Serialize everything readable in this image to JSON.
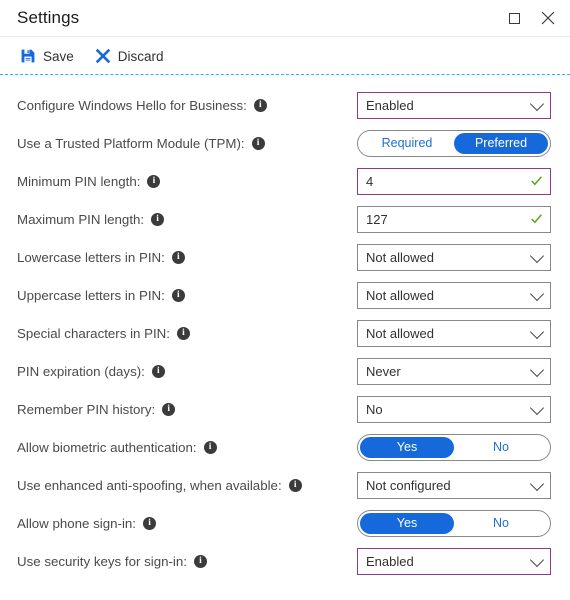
{
  "window": {
    "title": "Settings",
    "maximize_label": "Maximize",
    "close_label": "Close"
  },
  "toolbar": {
    "save_label": "Save",
    "discard_label": "Discard"
  },
  "colors": {
    "accent_blue": "#1569db",
    "modified_border": "#8c3a8c",
    "default_border": "#8a8886",
    "valid_check": "#5aa81d",
    "dashed_divider": "#2fb2ea"
  },
  "settings": [
    {
      "label": "Configure Windows Hello for Business:",
      "type": "dropdown",
      "value": "Enabled",
      "modified": true
    },
    {
      "label": "Use a Trusted Platform Module (TPM):",
      "type": "toggle",
      "options": [
        "Required",
        "Preferred"
      ],
      "selected": "Preferred"
    },
    {
      "label": "Minimum PIN length:",
      "type": "input",
      "value": "4",
      "modified": true,
      "valid": true
    },
    {
      "label": "Maximum PIN length:",
      "type": "input",
      "value": "127",
      "modified": false,
      "valid": true
    },
    {
      "label": "Lowercase letters in PIN:",
      "type": "dropdown",
      "value": "Not allowed",
      "modified": false
    },
    {
      "label": "Uppercase letters in PIN:",
      "type": "dropdown",
      "value": "Not allowed",
      "modified": false
    },
    {
      "label": "Special characters in PIN:",
      "type": "dropdown",
      "value": "Not allowed",
      "modified": false
    },
    {
      "label": "PIN expiration (days):",
      "type": "dropdown",
      "value": "Never",
      "modified": false
    },
    {
      "label": "Remember PIN history:",
      "type": "dropdown",
      "value": "No",
      "modified": false
    },
    {
      "label": "Allow biometric authentication:",
      "type": "toggle",
      "options": [
        "Yes",
        "No"
      ],
      "selected": "Yes"
    },
    {
      "label": "Use enhanced anti-spoofing, when available:",
      "type": "dropdown",
      "value": "Not configured",
      "modified": false
    },
    {
      "label": "Allow phone sign-in:",
      "type": "toggle",
      "options": [
        "Yes",
        "No"
      ],
      "selected": "Yes"
    },
    {
      "label": "Use security keys for sign-in:",
      "type": "dropdown",
      "value": "Enabled",
      "modified": true
    }
  ]
}
